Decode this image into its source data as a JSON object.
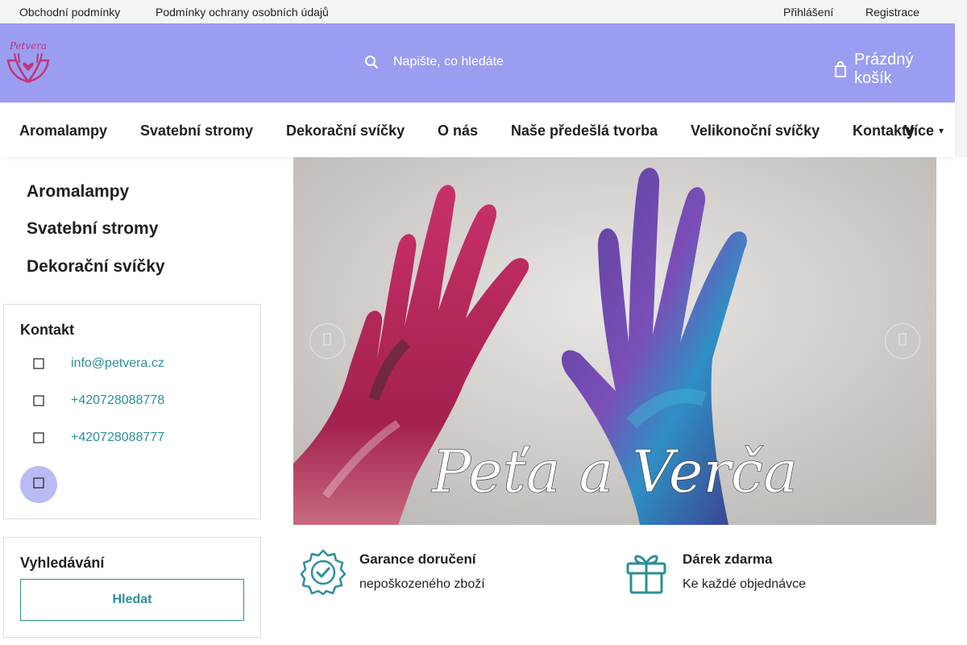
{
  "topbar": {
    "links_left": [
      "Obchodní podmínky",
      "Podmínky ochrany osobních údajů"
    ],
    "login": "Přihlášení",
    "register": "Registrace"
  },
  "header": {
    "logo_text": "Petvera",
    "search_placeholder": "Napište, co hledáte",
    "cart_label": "Prázdný košík",
    "brand_color": "#9b9ef0"
  },
  "nav": {
    "items": [
      "Aromalampy",
      "Svatební stromy",
      "Dekorační svíčky",
      "O nás",
      "Naše předešlá tvorba",
      "Velikonoční svíčky",
      "Kontakty"
    ],
    "more": "Více"
  },
  "sidebar": {
    "categories": [
      "Aromalampy",
      "Svatební stromy",
      "Dekorační svíčky"
    ],
    "contact": {
      "title": "Kontakt",
      "email": "info@petvera.cz",
      "phone1": "+420728088778",
      "phone2": "+420728088777"
    },
    "search": {
      "title": "Vyhledávání",
      "button": "Hledat"
    }
  },
  "banner": {
    "title": "Peťa a Verča"
  },
  "benefits": [
    {
      "title": "Garance doručení",
      "text": "nepoškozeného zboží",
      "icon": "badge-check-icon"
    },
    {
      "title": "Dárek zdarma",
      "text": "Ke každé objednávce",
      "icon": "gift-icon"
    }
  ],
  "colors": {
    "accent": "#2b8f97",
    "header": "#9b9ef0"
  }
}
